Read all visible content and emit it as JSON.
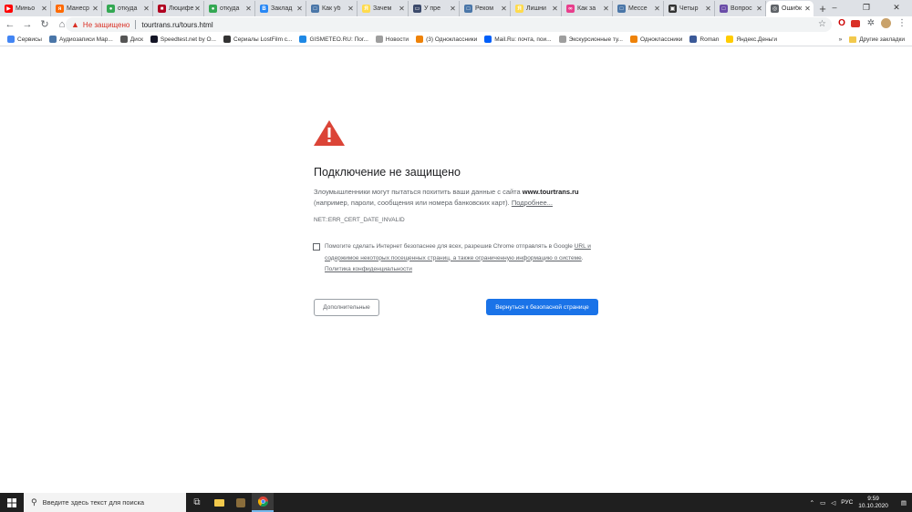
{
  "tabs": [
    {
      "title": "Миньо",
      "color": "#ff0000",
      "glyph": "▶"
    },
    {
      "title": "Манеср",
      "color": "#ff6a00",
      "glyph": "я"
    },
    {
      "title": "откуда",
      "color": "#34a853",
      "glyph": "●"
    },
    {
      "title": "Люцифе",
      "color": "#b00020",
      "glyph": "■"
    },
    {
      "title": "откуда",
      "color": "#34a853",
      "glyph": "●"
    },
    {
      "title": "Заклад",
      "color": "#2787f5",
      "glyph": "В"
    },
    {
      "title": "Как уб",
      "color": "#4a76a8",
      "glyph": "□"
    },
    {
      "title": "Зачем",
      "color": "#ffdb4d",
      "glyph": "Я"
    },
    {
      "title": "У пре",
      "color": "#3c4a6b",
      "glyph": "▭"
    },
    {
      "title": "Реком",
      "color": "#4a76a8",
      "glyph": "□"
    },
    {
      "title": "Лишни",
      "color": "#ffdb4d",
      "glyph": "Я"
    },
    {
      "title": "Как за",
      "color": "#e83e8c",
      "glyph": "∞"
    },
    {
      "title": "Мессе",
      "color": "#4a76a8",
      "glyph": "□"
    },
    {
      "title": "Четыр",
      "color": "#333333",
      "glyph": "▣"
    },
    {
      "title": "Вопрос",
      "color": "#6a4ca8",
      "glyph": "□"
    },
    {
      "title": "Ошибк",
      "color": "#5f6368",
      "glyph": "◎",
      "active": true
    }
  ],
  "window": {
    "minimize": "–",
    "maximize": "❐",
    "close": "✕",
    "new_tab": "+"
  },
  "toolbar": {
    "back": "←",
    "forward": "→",
    "reload": "↻",
    "home": "⌂",
    "security_label": "Не защищено",
    "url": "tourtrans.ru/tours.html",
    "star": "☆"
  },
  "bookmarks": [
    {
      "label": "Сервисы",
      "color": "#4285f4"
    },
    {
      "label": "Аудиозаписи Мар...",
      "color": "#4a76a8"
    },
    {
      "label": "Диск",
      "color": "#555555"
    },
    {
      "label": "Speedtest.net by O...",
      "color": "#141526"
    },
    {
      "label": "Сериалы LostFilm с...",
      "color": "#333333"
    },
    {
      "label": "GISMETEO.RU: Пог...",
      "color": "#1e88e5"
    },
    {
      "label": "Новости",
      "color": "#9e9e9e"
    },
    {
      "label": "(3) Одноклассники",
      "color": "#ee8208"
    },
    {
      "label": "Mail.Ru: почта, пои...",
      "color": "#005ff9"
    },
    {
      "label": "Экскурсионные ту...",
      "color": "#9e9e9e"
    },
    {
      "label": "Одноклассники",
      "color": "#ee8208"
    },
    {
      "label": "Roman",
      "color": "#3b5998"
    },
    {
      "label": "Яндекс.Деньги",
      "color": "#ffcc00"
    }
  ],
  "bookmarks_more": "»",
  "other_bookmarks": "Другие закладки",
  "page": {
    "title": "Подключение не защищено",
    "desc_prefix": "Злоумышленники могут пытаться похитить ваши данные с сайта ",
    "domain": "www.tourtrans.ru",
    "desc_suffix": " (например, пароли, сообщения или номера банковских карт). ",
    "more_link": "Подробнее...",
    "error_code": "NET::ERR_CERT_DATE_INVALID",
    "optin_prefix": "Помогите сделать Интернет безопаснее для всех, разрешив Chrome отправлять в Google ",
    "optin_link1": "URL и содержимое некоторых посещенных страниц, а также ограниченную информацию о системе",
    "optin_sep": ". ",
    "optin_link2": "Политика конфиденциальности",
    "advanced_button": "Дополнительные",
    "back_button": "Вернуться к безопасной странице"
  },
  "taskbar": {
    "search_placeholder": "Введите здесь текст для поиска",
    "tray_arrow": "⌃",
    "language": "РУС",
    "time": "9:59",
    "date": "10.10.2020"
  },
  "colors": {
    "accent": "#1a73e8",
    "warning": "#d93025"
  }
}
